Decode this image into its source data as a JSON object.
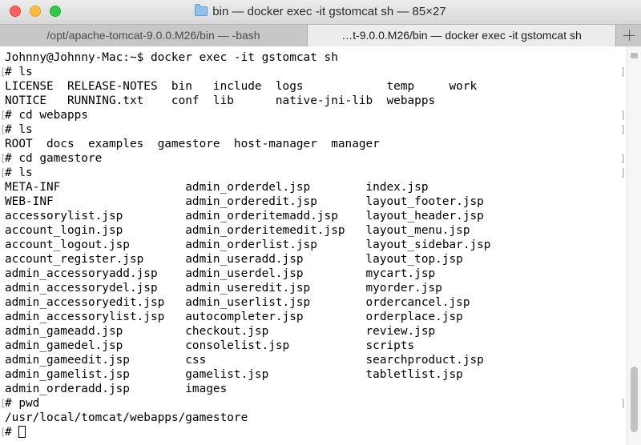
{
  "window": {
    "title": "bin — docker exec -it gstomcat sh — 85×27",
    "folder_icon": "folder-icon",
    "traffic_lights": {
      "close": "#fc605c",
      "minimize": "#fdbc40",
      "zoom": "#34c84a"
    }
  },
  "tabs": [
    {
      "label": "/opt/apache-tomcat-9.0.0.M26/bin — -bash",
      "active": false
    },
    {
      "label": "…t-9.0.0.M26/bin — docker exec -it gstomcat sh",
      "active": true
    }
  ],
  "new_tab_icon": "plus-icon",
  "terminal": {
    "lines": [
      "Johnny@Johnny-Mac:~$ docker exec -it gstomcat sh",
      "# ls",
      "LICENSE  RELEASE-NOTES  bin   include  logs            temp     work",
      "NOTICE   RUNNING.txt    conf  lib      native-jni-lib  webapps",
      "# cd webapps",
      "# ls",
      "ROOT  docs  examples  gamestore  host-manager  manager",
      "# cd gamestore",
      "# ls",
      "META-INF                  admin_orderdel.jsp        index.jsp",
      "WEB-INF                   admin_orderedit.jsp       layout_footer.jsp",
      "accessorylist.jsp         admin_orderitemadd.jsp    layout_header.jsp",
      "account_login.jsp         admin_orderitemedit.jsp   layout_menu.jsp",
      "account_logout.jsp        admin_orderlist.jsp       layout_sidebar.jsp",
      "account_register.jsp      admin_useradd.jsp         layout_top.jsp",
      "admin_accessoryadd.jsp    admin_userdel.jsp         mycart.jsp",
      "admin_accessorydel.jsp    admin_useredit.jsp        myorder.jsp",
      "admin_accessoryedit.jsp   admin_userlist.jsp        ordercancel.jsp",
      "admin_accessorylist.jsp   autocompleter.jsp         orderplace.jsp",
      "admin_gameadd.jsp         checkout.jsp              review.jsp",
      "admin_gamedel.jsp         consolelist.jsp           scripts",
      "admin_gameedit.jsp        css                       searchproduct.jsp",
      "admin_gamelist.jsp        gamelist.jsp              tabletlist.jsp",
      "admin_orderadd.jsp        images",
      "# pwd",
      "/usr/local/tomcat/webapps/gamestore",
      "# "
    ],
    "prompt_mark_open": "[",
    "prompt_mark_close": "]"
  }
}
